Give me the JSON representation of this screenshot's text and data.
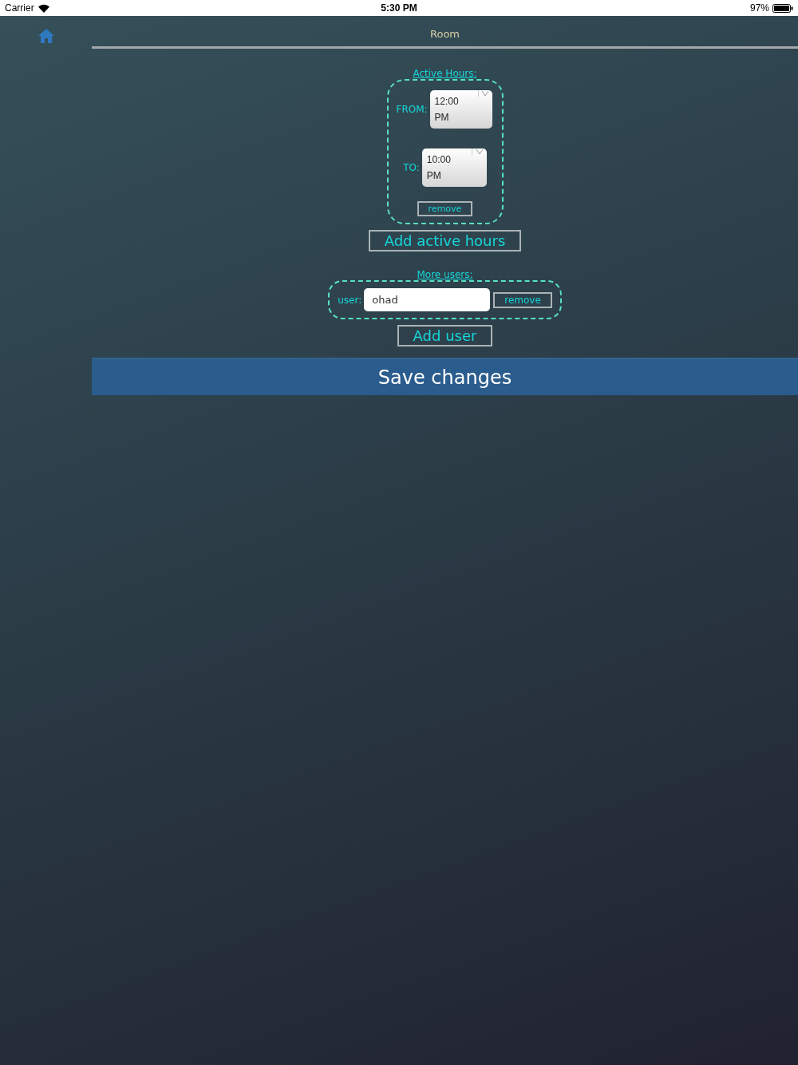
{
  "status_bar": {
    "carrier": "Carrier",
    "time": "5:30 PM",
    "battery": "97%"
  },
  "header": {
    "title": "Room"
  },
  "active_hours": {
    "title": "Active Hours:",
    "from_label": "FROM:",
    "from_value": "12:00 PM",
    "to_label": "TO:",
    "to_value": "10:00 PM",
    "remove": "remove",
    "add": "Add active hours"
  },
  "more_users": {
    "title": "More users:",
    "users": [
      {
        "label": "user:",
        "value": "ohad",
        "remove": "remove"
      }
    ],
    "add": "Add user"
  },
  "save": "Save changes"
}
